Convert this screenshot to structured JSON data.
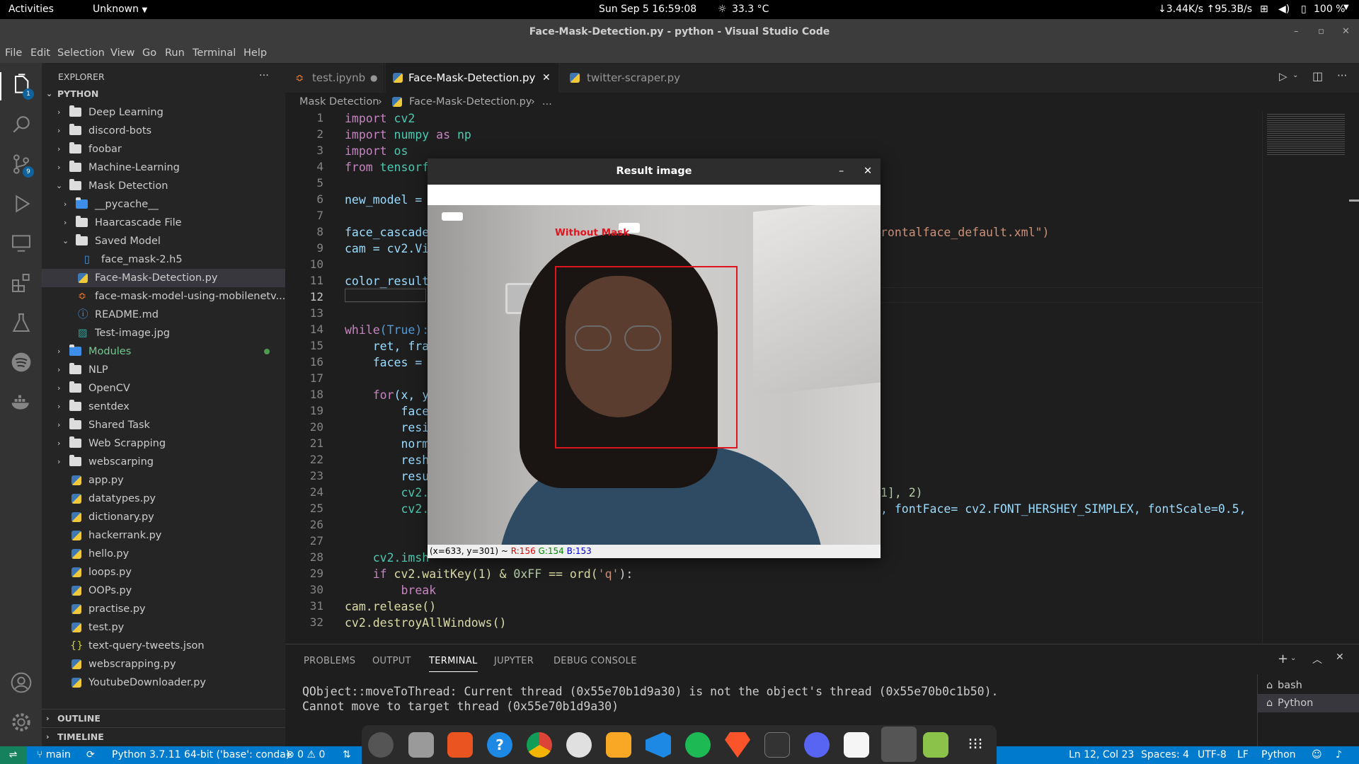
{
  "topbar": {
    "activities": "Activities",
    "app_menu": "Unknown",
    "clock": "Sun Sep 5  16:59:08",
    "weather": "33.3 °C",
    "network": "↓3.44K/s ↑95.3B/s",
    "battery": "100 %"
  },
  "window": {
    "title": "Face-Mask-Detection.py - python - Visual Studio Code"
  },
  "menu": [
    "File",
    "Edit",
    "Selection",
    "View",
    "Go",
    "Run",
    "Terminal",
    "Help"
  ],
  "activity": {
    "explorer_badge": "1",
    "scm_badge": "9"
  },
  "sidebar": {
    "header": "EXPLORER",
    "more": "···",
    "root": "PYTHON",
    "items": [
      {
        "label": "Deep Learning"
      },
      {
        "label": "discord-bots"
      },
      {
        "label": "foobar"
      },
      {
        "label": "Machine-Learning"
      },
      {
        "label": "Mask Detection"
      },
      {
        "label": "__pycache__"
      },
      {
        "label": "Haarcascade File"
      },
      {
        "label": "Saved Model"
      },
      {
        "label": "face_mask-2.h5"
      },
      {
        "label": "Face-Mask-Detection.py"
      },
      {
        "label": "face-mask-model-using-mobilenetv..."
      },
      {
        "label": "README.md"
      },
      {
        "label": "Test-image.jpg"
      },
      {
        "label": "Modules"
      },
      {
        "label": "NLP"
      },
      {
        "label": "OpenCV"
      },
      {
        "label": "sentdex"
      },
      {
        "label": "Shared Task"
      },
      {
        "label": "Web Scrapping"
      },
      {
        "label": "webscarping"
      },
      {
        "label": "app.py"
      },
      {
        "label": "datatypes.py"
      },
      {
        "label": "dictionary.py"
      },
      {
        "label": "hackerrank.py"
      },
      {
        "label": "hello.py"
      },
      {
        "label": "loops.py"
      },
      {
        "label": "OOPs.py"
      },
      {
        "label": "practise.py"
      },
      {
        "label": "test.py"
      },
      {
        "label": "text-query-tweets.json"
      },
      {
        "label": "webscrapping.py"
      },
      {
        "label": "YoutubeDownloader.py"
      }
    ],
    "outline": "OUTLINE",
    "timeline": "TIMELINE"
  },
  "tabs": [
    {
      "label": "test.ipynb"
    },
    {
      "label": "Face-Mask-Detection.py"
    },
    {
      "label": "twitter-scraper.py"
    }
  ],
  "breadcrumb": {
    "folder": "Mask Detection",
    "file": "Face-Mask-Detection.py",
    "more": "..."
  },
  "code": {
    "line_numbers": [
      "1",
      "2",
      "3",
      "4",
      "5",
      "6",
      "7",
      "8",
      "9",
      "10",
      "11",
      "12",
      "13",
      "14",
      "15",
      "16",
      "17",
      "18",
      "19",
      "20",
      "21",
      "22",
      "23",
      "24",
      "25",
      "26",
      "27",
      "28",
      "29",
      "30",
      "31",
      "32"
    ],
    "l1_kw": "import",
    "l1_mod": " cv2",
    "l2_kw": "import",
    "l2_mod": " numpy",
    "l2_as": " as",
    "l2_alias": " np",
    "l3_kw": "import",
    "l3_mod": " os",
    "l4_kw": "from",
    "l4_mod": " tensorf",
    "l6": "new_model =",
    "l8": "face_cascade",
    "l8_tail": "rontalface_default.xml\")",
    "l9": "cam = cv2.Vi",
    "l11": "color_result",
    "l14_kw": "while",
    "l14_rest": "(True):",
    "l15": "    ret, fra",
    "l16": "    faces =",
    "l18_kw": "    for",
    "l18_rest": "(x, y",
    "l19": "        face",
    "l20": "        resi",
    "l21": "        norm",
    "l22": "        resh",
    "l23": "        resu",
    "l24": "        cv2.",
    "l24_tail": "1], 2)",
    "l25": "        cv2.",
    "l25_tail": ", fontFace= cv2.FONT_HERSHEY_SIMPLEX, fontScale=0.5,",
    "l28": "    cv2.imsh",
    "l29_kw": "    if",
    "l29_rest": " cv2.waitKey(1) & ",
    "l29_hex": "0xFF",
    "l29_end": " == ord(",
    "l29_str": "'q'",
    "l29_close": "):",
    "l30": "        break",
    "l31": "cam.release()",
    "l32": "cv2.destroyAllWindows()"
  },
  "panel": {
    "tabs": [
      "PROBLEMS",
      "OUTPUT",
      "TERMINAL",
      "JUPYTER",
      "DEBUG CONSOLE"
    ],
    "terminal_line1": "QObject::moveToThread: Current thread (0x55e70b1d9a30) is not the object's thread (0x55e70b0c1b50).",
    "terminal_line2": "Cannot move to target thread (0x55e70b1d9a30)",
    "shells": [
      "bash",
      "Python"
    ]
  },
  "result_window": {
    "title": "Result image",
    "label": "Without Mask",
    "status_coords": "(x=633, y=301) ~ ",
    "status_r": "R:156",
    "status_g": "G:154",
    "status_b": "B:153"
  },
  "statusbar": {
    "branch": "main",
    "interpreter": "Python 3.7.11 64-bit ('base': conda)",
    "problems": "⊗ 0 ⚠ 0",
    "position": "Ln 12, Col 23",
    "spaces": "Spaces: 4",
    "encoding": "UTF-8",
    "eol": "LF",
    "language": "Python"
  },
  "colors": {
    "accent": "#007acc",
    "detection_box": "#e0141e"
  }
}
